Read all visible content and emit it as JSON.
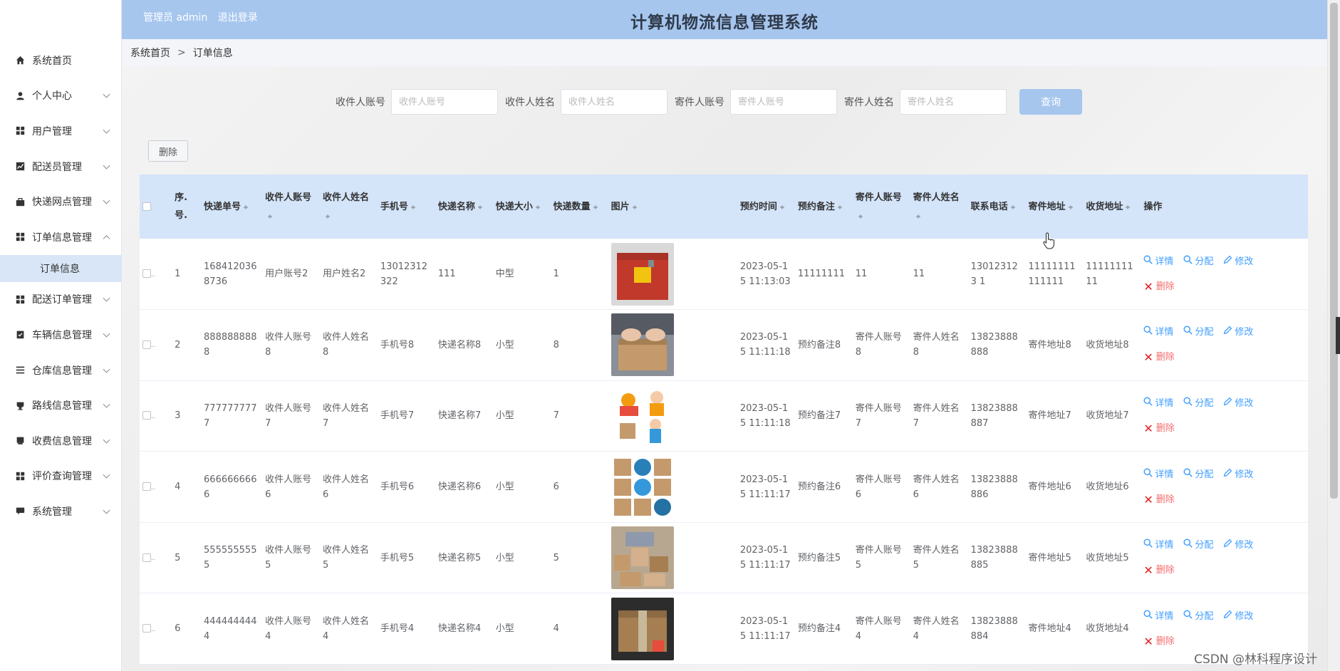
{
  "header": {
    "admin_label": "管理员 admin",
    "logout_label": "退出登录",
    "title": "计算机物流信息管理系统"
  },
  "sidebar": {
    "items": [
      {
        "label": "系统首页",
        "icon": "home-icon"
      },
      {
        "label": "个人中心",
        "icon": "user-icon"
      },
      {
        "label": "用户管理",
        "icon": "grid-icon"
      },
      {
        "label": "配送员管理",
        "icon": "chart-icon"
      },
      {
        "label": "快递网点管理",
        "icon": "briefcase-icon"
      },
      {
        "label": "订单信息管理",
        "icon": "grid-icon",
        "expanded": true
      },
      {
        "label": "配送订单管理",
        "icon": "grid-icon"
      },
      {
        "label": "车辆信息管理",
        "icon": "clipboard-icon"
      },
      {
        "label": "仓库信息管理",
        "icon": "list-icon"
      },
      {
        "label": "路线信息管理",
        "icon": "trophy-icon"
      },
      {
        "label": "收费信息管理",
        "icon": "book-icon"
      },
      {
        "label": "评价查询管理",
        "icon": "grid-icon"
      },
      {
        "label": "系统管理",
        "icon": "message-icon"
      }
    ],
    "sub_item": "订单信息"
  },
  "breadcrumb": {
    "home": "系统首页",
    "separator": ">",
    "current": "订单信息"
  },
  "search": {
    "fields": [
      {
        "label": "收件人账号",
        "placeholder": "收件人账号"
      },
      {
        "label": "收件人姓名",
        "placeholder": "收件人姓名"
      },
      {
        "label": "寄件人账号",
        "placeholder": "寄件人账号"
      },
      {
        "label": "寄件人姓名",
        "placeholder": "寄件人姓名"
      }
    ],
    "query_label": "查询"
  },
  "toolbar": {
    "delete_label": "删除"
  },
  "table": {
    "headers": [
      "序.号.",
      "快递单号",
      "收件人账号",
      "收件人姓名",
      "手机号",
      "快递名称",
      "快递大小",
      "快递数量",
      "图片",
      "预约时间",
      "预约备注",
      "寄件人账号",
      "寄件人姓名",
      "联系电话",
      "寄件地址",
      "收货地址",
      "操作"
    ],
    "rows": [
      {
        "no": "1",
        "tracking": "1684120368736",
        "recv_acct": "用户账号2",
        "recv_name": "用户姓名2",
        "phone": "13012312322",
        "name": "111",
        "size": "中型",
        "qty": "1",
        "image": "red-box",
        "time": "2023-05-15 11:13:03",
        "note": "11111111",
        "send_acct": "11",
        "send_name": "11",
        "contact": "130123123 1",
        "send_addr": "11111111111111",
        "recv_addr": "1111111111"
      },
      {
        "no": "2",
        "tracking": "8888888888",
        "recv_acct": "收件人账号8",
        "recv_name": "收件人姓名8",
        "phone": "手机号8",
        "name": "快递名称8",
        "size": "小型",
        "qty": "8",
        "image": "packing-box",
        "time": "2023-05-15 11:11:18",
        "note": "预约备注8",
        "send_acct": "寄件人账号8",
        "send_name": "寄件人姓名8",
        "contact": "13823888888",
        "send_addr": "寄件地址8",
        "recv_addr": "收货地址8"
      },
      {
        "no": "3",
        "tracking": "7777777777",
        "recv_acct": "收件人账号7",
        "recv_name": "收件人姓名7",
        "phone": "手机号7",
        "name": "快递名称7",
        "size": "小型",
        "qty": "7",
        "image": "delivery-cartoon",
        "time": "2023-05-15 11:11:18",
        "note": "预约备注7",
        "send_acct": "寄件人账号7",
        "send_name": "寄件人姓名7",
        "contact": "13823888887",
        "send_addr": "寄件地址7",
        "recv_addr": "收货地址7"
      },
      {
        "no": "4",
        "tracking": "6666666666",
        "recv_acct": "收件人账号6",
        "recv_name": "收件人姓名6",
        "phone": "手机号6",
        "name": "快递名称6",
        "size": "小型",
        "qty": "6",
        "image": "logistics-icons",
        "time": "2023-05-15 11:11:17",
        "note": "预约备注6",
        "send_acct": "寄件人账号6",
        "send_name": "寄件人姓名6",
        "contact": "13823888886",
        "send_addr": "寄件地址6",
        "recv_addr": "收货地址6"
      },
      {
        "no": "5",
        "tracking": "5555555555",
        "recv_acct": "收件人账号5",
        "recv_name": "收件人姓名5",
        "phone": "手机号5",
        "name": "快递名称5",
        "size": "小型",
        "qty": "5",
        "image": "parcel-pile",
        "time": "2023-05-15 11:11:17",
        "note": "预约备注5",
        "send_acct": "寄件人账号5",
        "send_name": "寄件人姓名5",
        "contact": "13823888885",
        "send_addr": "寄件地址5",
        "recv_addr": "收货地址5"
      },
      {
        "no": "6",
        "tracking": "4444444444",
        "recv_acct": "收件人账号4",
        "recv_name": "收件人姓名4",
        "phone": "手机号4",
        "name": "快递名称4",
        "size": "小型",
        "qty": "4",
        "image": "cardboard-box",
        "time": "2023-05-15 11:11:17",
        "note": "预约备注4",
        "send_acct": "寄件人账号4",
        "send_name": "寄件人姓名4",
        "contact": "13823888884",
        "send_addr": "寄件地址4",
        "recv_addr": "收货地址4"
      }
    ],
    "actions": {
      "detail": "详情",
      "assign": "分配",
      "edit": "修改",
      "delete": "删除"
    }
  },
  "watermark": "CSDN @林科程序设计",
  "colors": {
    "header_bg": "#a6c6ee",
    "table_head_bg": "#d4e4f9",
    "link": "#409eff",
    "danger": "#f56c6c",
    "submenu_active": "#d8e6f7"
  }
}
